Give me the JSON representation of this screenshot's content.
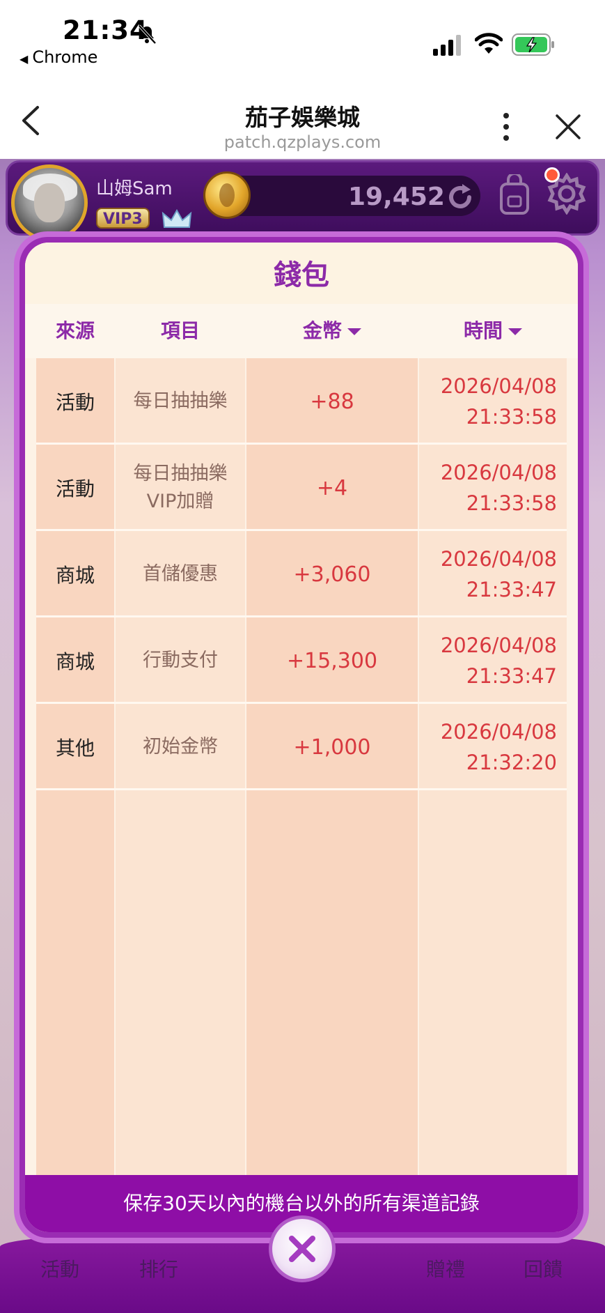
{
  "status_bar": {
    "time": "21:34",
    "back_app": "Chrome"
  },
  "browser": {
    "title": "茄子娛樂城",
    "url": "patch.qzplays.com"
  },
  "player": {
    "name": "山姆Sam",
    "vip": "VIP3",
    "coins": "19,452"
  },
  "wallet": {
    "title": "錢包",
    "columns": {
      "source": "來源",
      "item": "項目",
      "coins": "金幣",
      "time": "時間"
    },
    "rows": [
      {
        "source": "活動",
        "item": [
          "每日抽抽樂"
        ],
        "coins": "+88",
        "date": "2026/04/08",
        "time": "21:33:58"
      },
      {
        "source": "活動",
        "item": [
          "每日抽抽樂",
          "VIP加贈"
        ],
        "coins": "+4",
        "date": "2026/04/08",
        "time": "21:33:58"
      },
      {
        "source": "商城",
        "item": [
          "首儲優惠"
        ],
        "coins": "+3,060",
        "date": "2026/04/08",
        "time": "21:33:47"
      },
      {
        "source": "商城",
        "item": [
          "行動支付"
        ],
        "coins": "+15,300",
        "date": "2026/04/08",
        "time": "21:33:47"
      },
      {
        "source": "其他",
        "item": [
          "初始金幣"
        ],
        "coins": "+1,000",
        "date": "2026/04/08",
        "time": "21:32:20"
      }
    ],
    "footer_note": "保存30天以內的機台以外的所有渠道記錄"
  },
  "bottom_nav": {
    "left_label": "活動",
    "left2_label": "排行",
    "right2_label": "贈禮",
    "right_label": "回饋"
  },
  "colors": {
    "accent_purple": "#8c2aa8",
    "coin_red": "#d8383f",
    "footer_bg": "#8e0ea6"
  }
}
